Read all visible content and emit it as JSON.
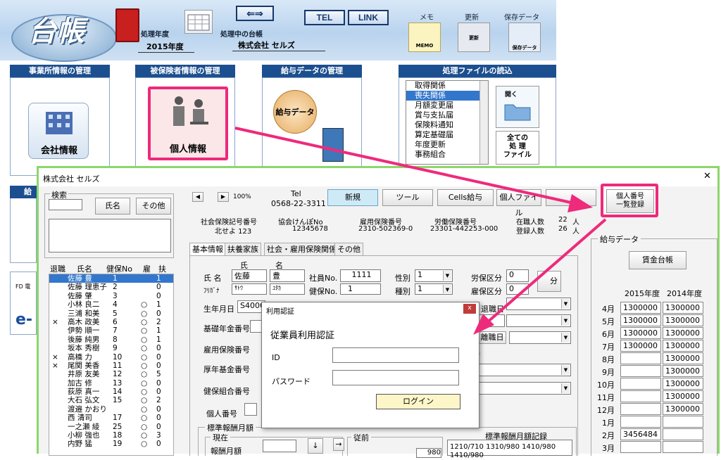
{
  "app": {
    "title_logo": "台帳",
    "fiscal_label": "処理年度",
    "fiscal_value": "2015年度",
    "company_label": "処理中の台帳",
    "company_value": "株式会社 セルズ",
    "tel": "TEL",
    "link": "LINK",
    "memo_label": "メモ",
    "memo_icon": "MEMO",
    "update_label": "更新",
    "update_icon": "更新",
    "save_label": "保存データ",
    "save_icon": "保存データ"
  },
  "sections": {
    "office": "事業所情報の管理",
    "office_btn": "会社情報",
    "insured": "被保険者情報の管理",
    "insured_btn": "個人情報",
    "salary": "給与データの管理",
    "salary_btn": "給与データ",
    "files": "処理ファイルの読込",
    "open": "開く",
    "all_files": "全ての\n処 理\nファイル"
  },
  "file_list": [
    "取得関係",
    "喪失関係",
    "月額変更届",
    "賞与支払届",
    "保険料通知",
    "算定基礎届",
    "年度更新",
    "事務組合"
  ],
  "window": {
    "title": "株式会社 セルズ",
    "close": "✕",
    "search": "検索",
    "name_btn": "氏名",
    "other_btn": "その他",
    "zoom": "100%",
    "tel_label": "Tel",
    "tel_value": "0568-22-3311",
    "new_btn": "新規",
    "tool_btn": "ツール",
    "cells_btn": "Cells給与",
    "personal_file_btn": "個人ファイル",
    "mynumber_btn": "個人番号\n一覧登録"
  },
  "codes": {
    "shaho_label": "社会保険記号番号",
    "shaho_value": "北せよ 123",
    "kyokai_label": "協会けんぽNo",
    "kyokai_value": "12345678",
    "koyo_label": "雇用保険番号",
    "koyo_value": "2310-502369-0",
    "rodo_label": "労働保険番号",
    "rodo_value": "23301-442253-000",
    "zaishoku_label": "在職人数",
    "zaishoku_value": "22",
    "toroku_label": "登録人数",
    "toroku_value": "26",
    "nin": "人"
  },
  "list_headers": {
    "retired": "退職",
    "name": "氏名",
    "kenpo": "健保No",
    "koyo": "雇",
    "fu": "扶"
  },
  "employees": [
    {
      "r": "",
      "n": "佐藤 豊",
      "k": "1",
      "y": "",
      "f": "1",
      "sel": true
    },
    {
      "r": "",
      "n": "佐藤 理恵子",
      "k": "2",
      "y": "",
      "f": "0"
    },
    {
      "r": "",
      "n": "佐藤 肇",
      "k": "3",
      "y": "",
      "f": "0"
    },
    {
      "r": "",
      "n": "小林 良二",
      "k": "4",
      "y": "○",
      "f": "1"
    },
    {
      "r": "",
      "n": "三浦 和美",
      "k": "5",
      "y": "○",
      "f": "0"
    },
    {
      "r": "×",
      "n": "高木 政美",
      "k": "6",
      "y": "○",
      "f": "2"
    },
    {
      "r": "",
      "n": "伊勢 順一",
      "k": "7",
      "y": "○",
      "f": "1"
    },
    {
      "r": "",
      "n": "後藤 純男",
      "k": "8",
      "y": "○",
      "f": "1"
    },
    {
      "r": "",
      "n": "坂本 秀樹",
      "k": "9",
      "y": "○",
      "f": "0"
    },
    {
      "r": "×",
      "n": "高橋 力",
      "k": "10",
      "y": "○",
      "f": "0"
    },
    {
      "r": "×",
      "n": "尾関 美香",
      "k": "11",
      "y": "○",
      "f": "0"
    },
    {
      "r": "",
      "n": "井原 友美",
      "k": "12",
      "y": "○",
      "f": "5"
    },
    {
      "r": "",
      "n": "加古 修",
      "k": "13",
      "y": "○",
      "f": "0"
    },
    {
      "r": "",
      "n": "荻原 真一",
      "k": "14",
      "y": "○",
      "f": "0"
    },
    {
      "r": "",
      "n": "大石 弘文",
      "k": "15",
      "y": "○",
      "f": "2"
    },
    {
      "r": "",
      "n": "渡邉 かおり",
      "k": "",
      "y": "○",
      "f": "0"
    },
    {
      "r": "",
      "n": "西 清司",
      "k": "17",
      "y": "○",
      "f": "0"
    },
    {
      "r": "",
      "n": "一之瀬 綾",
      "k": "25",
      "y": "○",
      "f": "0"
    },
    {
      "r": "",
      "n": "小柳 強也",
      "k": "18",
      "y": "○",
      "f": "3"
    },
    {
      "r": "",
      "n": "内野 猛",
      "k": "19",
      "y": "○",
      "f": "0"
    }
  ],
  "tabs": [
    "基本情報",
    "扶養家族",
    "社会・雇用保険関係",
    "その他"
  ],
  "form": {
    "shi": "氏",
    "mei": "名",
    "name_label": "氏 名",
    "last": "佐藤",
    "first": "豊",
    "kana_label": "ﾌﾘｶﾞﾅ",
    "last_kana": "ｻﾄｳ",
    "first_kana": "ﾕﾀｶ",
    "empno_label": "社員No.",
    "empno": "1111",
    "kenpo_label": "健保No.",
    "kenpo": "1",
    "sex_label": "性別",
    "sex": "1",
    "type_label": "種別",
    "type": "1",
    "rouho_label": "労保区分",
    "rouho": "0",
    "koyo_label": "雇保区分",
    "koyo": "0",
    "kubun": "分",
    "birth_label": "生年月日",
    "birth": "S4000",
    "kiso_label": "基礎年金番号",
    "koyo_no_label": "雇用保険番号",
    "kosei_label": "厚年基金番号",
    "kenpo_kumiai_label": "健保組合番号",
    "mynum_label": "個人番号",
    "retire_label": "退職日",
    "resign_label": "離職日",
    "std_label": "標準報酬月額",
    "current_label": "現在",
    "prev_label": "従前",
    "monthly_label": "報酬月額",
    "arrow": "↓",
    "right_arrow": "→",
    "std_record_label": "標準報酬月額記録",
    "std_record": "1210/710 1310/980 1410/980\n1410/980",
    "prev_val": "980"
  },
  "dialog": {
    "title": "利用認証",
    "close": "x",
    "heading": "従業員利用認証",
    "id_label": "ID",
    "pw_label": "パスワード",
    "login": "ログイン"
  },
  "salary": {
    "group": "給与データ",
    "ledger_btn": "賃金台帳",
    "y2015": "2015年度",
    "y2014": "2014年度",
    "rows": [
      {
        "m": "4月",
        "a": "1300000",
        "b": "1300000"
      },
      {
        "m": "5月",
        "a": "1300000",
        "b": "1300000"
      },
      {
        "m": "6月",
        "a": "1300000",
        "b": "1300000"
      },
      {
        "m": "7月",
        "a": "1300000",
        "b": "1300000"
      },
      {
        "m": "8月",
        "a": "",
        "b": "1300000"
      },
      {
        "m": "9月",
        "a": "",
        "b": "1300000"
      },
      {
        "m": "10月",
        "a": "",
        "b": "1300000"
      },
      {
        "m": "11月",
        "a": "",
        "b": "1300000"
      },
      {
        "m": "12月",
        "a": "",
        "b": "1300000"
      },
      {
        "m": "1月",
        "a": "",
        "b": ""
      },
      {
        "m": "2月",
        "a": "3456484",
        "b": ""
      },
      {
        "m": "3月",
        "a": "",
        "b": ""
      }
    ]
  },
  "left_misc": {
    "fd": "FD 電",
    "e": "e-"
  },
  "colors": {
    "accent": "#ee2a7b",
    "frame": "#8cd76a",
    "header": "#1c4f8f"
  }
}
